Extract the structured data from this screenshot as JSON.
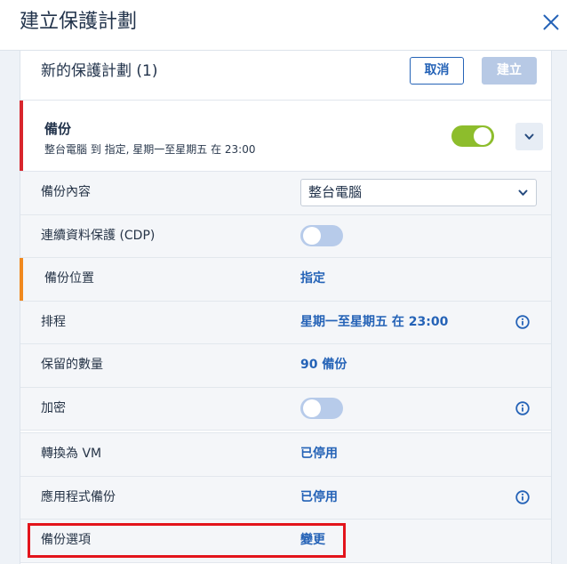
{
  "dialog": {
    "title": "建立保護計劃",
    "close_icon": "close-icon"
  },
  "plan": {
    "title": "新的保護計劃 (1)",
    "cancel_label": "取消",
    "create_label": "建立",
    "create_enabled": false
  },
  "backup": {
    "title": "備份",
    "summary": "整台電腦 到 指定, 星期一至星期五 在 23:00",
    "enabled": true,
    "expand_icon": "chevron-down-icon"
  },
  "rows": [
    {
      "label": "備份內容",
      "value": "整台電腦",
      "dropdown_icon": "chevron-down-icon"
    },
    {
      "label": "連續資料保護 (CDP)",
      "enabled": false
    },
    {
      "label": "備份位置",
      "value": "指定",
      "status_color": "#f0891f"
    },
    {
      "label": "排程",
      "value": "星期一至星期五 在 23:00",
      "info_icon": "info-icon"
    },
    {
      "label": "保留的數量",
      "value": "90 備份"
    },
    {
      "label": "加密",
      "enabled": false,
      "info_icon": "info-icon"
    },
    {
      "label": "轉換為 VM",
      "value": "已停用"
    },
    {
      "label": "應用程式備份",
      "value": "已停用",
      "info_icon": "info-icon"
    },
    {
      "label": "備份選項",
      "value": "變更",
      "highlighted": true
    }
  ],
  "colors": {
    "accent": "#2563b7",
    "toggle_on": "#8dbd2c",
    "toggle_off": "#b7cbea",
    "disabled": "#b7c9e5",
    "error": "#d8262d",
    "warning": "#f0891f",
    "highlight": "#e3141b"
  }
}
